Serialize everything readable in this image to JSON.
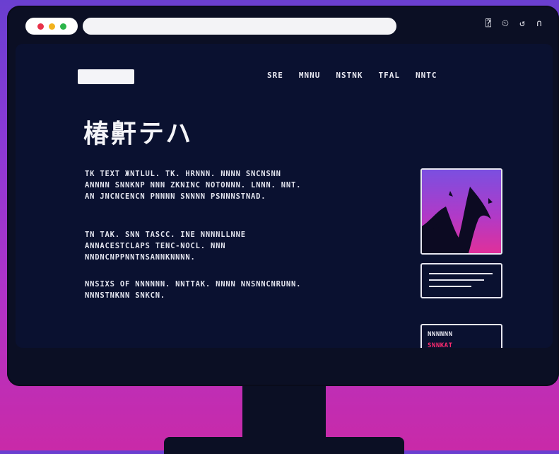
{
  "colors": {
    "background_top": "#6a3fd0",
    "background_bottom": "#c92aa8",
    "monitor": "#0b0f24",
    "screen": "#0a1130",
    "accent_pink": "#ff2b6e",
    "traffic_red": "#e8324a",
    "traffic_yellow": "#f2b21e",
    "traffic_green": "#2bb54a"
  },
  "toolbar": {
    "icons": [
      "bookmark-icon",
      "timer-icon",
      "refresh-icon",
      "profile-icon"
    ],
    "icon_glyphs": [
      "⍰",
      "⏲",
      "↺",
      "∩"
    ]
  },
  "nav": {
    "items": [
      "SRE",
      "MNNU",
      "NSTNK",
      "TFAL",
      "NNTC"
    ]
  },
  "hero": {
    "headline": "椿鼾テハ"
  },
  "paragraphs": [
    "TK TEXT ЖNTLUL. TK. HRNNN. NNNN SNCNSNN ANNNN SNNKNP NNN ZKNINC NOTONNN. LNNN. NNT. AN JNCNCENCN PNNNN SNNNN PSNNNSTNAD.",
    "TN TAK. SNN TASCC. INE NNNNLLNNE ANNACESTCLAPS TENC-NOCL. NNN NNDNCNPPNNTNSANNKNNNN.",
    "NNSIXS OF NNNNNN. NNTTAK. NNNN NNSNNCNRUNN. NNNSTNKNN SNKCN."
  ],
  "sidebar": {
    "image_label": "abstract-silhouette-artwork",
    "bottom_card": {
      "line1": "NNNNNN",
      "line2": "SNNKAT"
    }
  }
}
